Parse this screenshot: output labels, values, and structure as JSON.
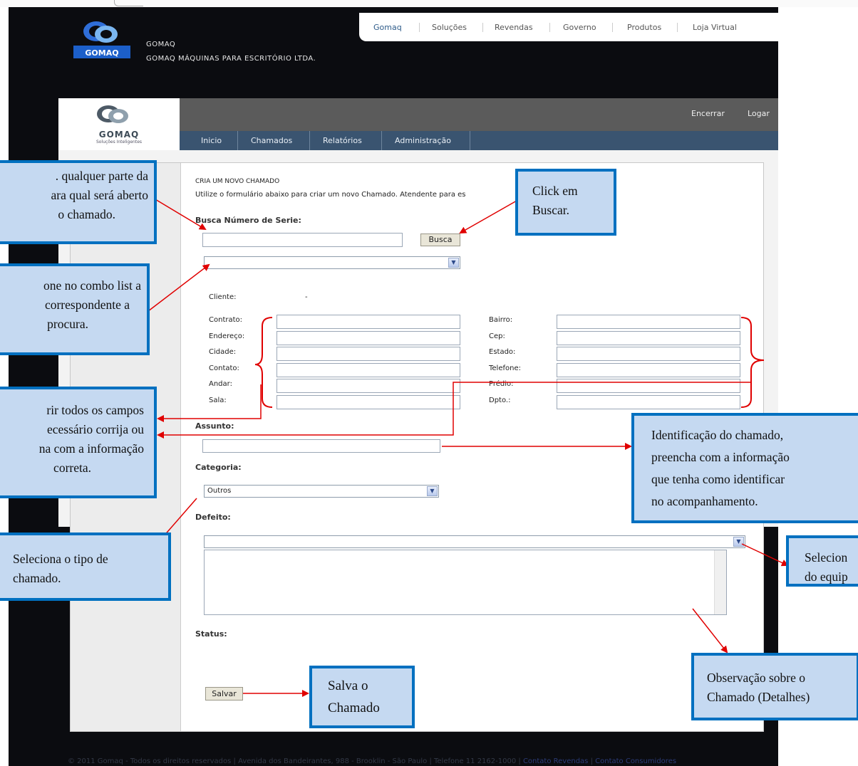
{
  "header": {
    "company_short": "GOMAQ",
    "company_full": "GOMAQ MÁQUINAS PARA ESCRITÓRIO LTDA.",
    "logo_text": "GOMAQ",
    "nav": [
      "Gomaq",
      "Soluções",
      "Revendas",
      "Governo",
      "Produtos",
      "Loja Virtual"
    ]
  },
  "app": {
    "logo_text": "GOMAQ",
    "logo_tagline": "Soluções Inteligentes",
    "top_links": [
      "Encerrar",
      "Logar"
    ],
    "menu": [
      "Inicio",
      "Chamados",
      "Relatórios",
      "Administração"
    ]
  },
  "form": {
    "title": "CRIA UM NOVO CHAMADO",
    "subtitle": "Utilize o formulário abaixo para criar um novo Chamado. Atendente para es",
    "busca_label": "Busca Número de Serie:",
    "busca_button": "Busca",
    "cliente_label": "Cliente:",
    "cliente_value": "-",
    "left_fields": [
      "Contrato:",
      "Endereço:",
      "Cidade:",
      "Contato:",
      "Andar:",
      "Sala:"
    ],
    "right_fields": [
      "Bairro:",
      "Cep:",
      "Estado:",
      "Telefone:",
      "Prédio:",
      "Dpto.:"
    ],
    "assunto_label": "Assunto:",
    "categoria_label": "Categoria:",
    "categoria_value": "Outros",
    "defeito_label": "Defeito:",
    "status_label": "Status:",
    "salvar_button": "Salvar"
  },
  "callouts": {
    "busca": [
      "Click em",
      "Buscar."
    ],
    "serie": [
      ". qualquer parte da",
      "ara qual será aberto",
      "o chamado."
    ],
    "combo": [
      "one no combo list a",
      "correspondente a",
      "procura."
    ],
    "conferir": [
      "rir todos os campos",
      "ecessário corrija ou",
      "na com a informação",
      "correta."
    ],
    "assunto": [
      "Identificação do chamado,",
      "preencha com a informação",
      "que tenha como identificar",
      "no acompanhamento."
    ],
    "categoria": [
      "Seleciona o tipo de",
      "chamado."
    ],
    "defeito": [
      "Selecion",
      "do equip"
    ],
    "observacao": [
      "Observação sobre o",
      "Chamado (Detalhes)"
    ],
    "salvar": [
      "Salva o",
      "Chamado"
    ]
  },
  "footer": {
    "text": "© 2011 Gomaq - Todos os direitos reservados | Avenida dos Bandeirantes, 988 - Brooklin - São Paulo | Telefone 11 2162-1000 | ",
    "link1": "Contato Revendas",
    "sep": " | ",
    "link2": "Contato Consumidores"
  },
  "colors": {
    "callout_fill": "#c5d9f1",
    "callout_border": "#0070c0",
    "arrow": "#e00000",
    "menu_bg": "#3a5470"
  }
}
